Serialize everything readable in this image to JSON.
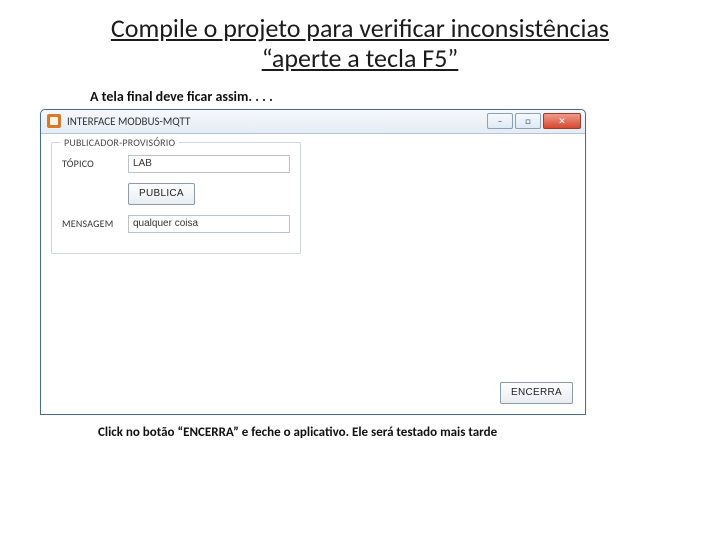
{
  "slide": {
    "title_line1": "Compile o projeto para verificar inconsistências",
    "title_line2": "“aperte a tecla F5”",
    "caption_above": "A tela final deve  ficar assim. . . .",
    "caption_below": "Click no botão “ENCERRA” e feche o aplicativo. Ele será testado mais tarde"
  },
  "window": {
    "title": "INTERFACE MODBUS-MQTT",
    "buttons": {
      "minimize": "–",
      "maximize": "□",
      "close": "✕"
    }
  },
  "group": {
    "legend": "PUBLICADOR-PROVISÓRIO",
    "topic_label": "TÓPICO",
    "topic_value": "LAB",
    "publish_label": "PUBLICA",
    "message_label": "MENSAGEM",
    "message_value": "qualquer coisa"
  },
  "footer": {
    "encerra_label": "ENCERRA"
  }
}
